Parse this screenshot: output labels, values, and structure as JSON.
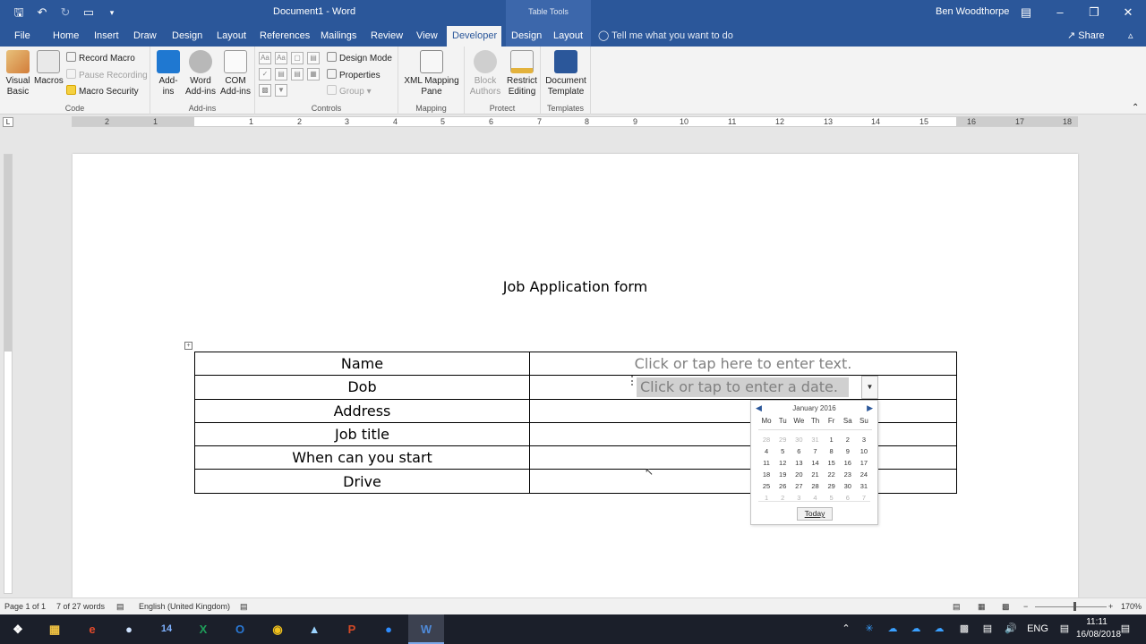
{
  "app": {
    "doc_title": "Document1 - Word",
    "context_tab_label": "Table Tools",
    "user_name": "Ben Woodthorpe",
    "accent": "#2b579a"
  },
  "tabs": [
    "File",
    "Home",
    "Insert",
    "Draw",
    "Design",
    "Layout",
    "References",
    "Mailings",
    "Review",
    "View",
    "Developer",
    "Design",
    "Layout"
  ],
  "active_tab": "Developer",
  "tell_me": "Tell me what you want to do",
  "share_label": "Share",
  "ribbon": {
    "code": {
      "label": "Code",
      "visual_basic": "Visual Basic",
      "macros": "Macros",
      "record_macro": "Record Macro",
      "pause_recording": "Pause Recording",
      "macro_security": "Macro Security"
    },
    "addins": {
      "label": "Add-ins",
      "add_ins": "Add-ins",
      "word_add_ins": "Word Add-ins",
      "com_add_ins": "COM Add-ins"
    },
    "controls": {
      "label": "Controls",
      "design_mode": "Design Mode",
      "properties": "Properties",
      "group": "Group"
    },
    "mapping": {
      "label": "Mapping",
      "xml_mapping_pane": "XML Mapping Pane"
    },
    "protect": {
      "label": "Protect",
      "block_authors": "Block Authors",
      "restrict_editing": "Restrict Editing"
    },
    "templates": {
      "label": "Templates",
      "document_template": "Document Template"
    }
  },
  "ruler": {
    "ticks": [
      "2",
      "1",
      "1",
      "2",
      "3",
      "4",
      "5",
      "6",
      "7",
      "8",
      "9",
      "10",
      "11",
      "12",
      "13",
      "14",
      "15",
      "16",
      "17",
      "18"
    ]
  },
  "document": {
    "heading": "Job Application form",
    "rows": [
      {
        "label": "Name",
        "value": "Click or tap here to enter text."
      },
      {
        "label": "Dob",
        "value": ""
      },
      {
        "label": "Address",
        "value": ""
      },
      {
        "label": "Job title",
        "value": ""
      },
      {
        "label": "When can you start",
        "value": ""
      },
      {
        "label": "Drive",
        "value": ""
      }
    ],
    "date_placeholder": "Click or tap to enter a date."
  },
  "calendar": {
    "month": "January 2016",
    "weekdays": [
      "Mo",
      "Tu",
      "We",
      "Th",
      "Fr",
      "Sa",
      "Su"
    ],
    "days": [
      {
        "d": "28",
        "other": true
      },
      {
        "d": "29",
        "other": true
      },
      {
        "d": "30",
        "other": true
      },
      {
        "d": "31",
        "other": true
      },
      {
        "d": "1"
      },
      {
        "d": "2"
      },
      {
        "d": "3"
      },
      {
        "d": "4"
      },
      {
        "d": "5"
      },
      {
        "d": "6"
      },
      {
        "d": "7"
      },
      {
        "d": "8"
      },
      {
        "d": "9"
      },
      {
        "d": "10"
      },
      {
        "d": "11"
      },
      {
        "d": "12"
      },
      {
        "d": "13"
      },
      {
        "d": "14"
      },
      {
        "d": "15"
      },
      {
        "d": "16"
      },
      {
        "d": "17"
      },
      {
        "d": "18"
      },
      {
        "d": "19"
      },
      {
        "d": "20"
      },
      {
        "d": "21"
      },
      {
        "d": "22"
      },
      {
        "d": "23"
      },
      {
        "d": "24"
      },
      {
        "d": "25"
      },
      {
        "d": "26"
      },
      {
        "d": "27"
      },
      {
        "d": "28"
      },
      {
        "d": "29"
      },
      {
        "d": "30"
      },
      {
        "d": "31"
      },
      {
        "d": "1",
        "other": true
      },
      {
        "d": "2",
        "other": true
      },
      {
        "d": "3",
        "other": true
      },
      {
        "d": "4",
        "other": true
      },
      {
        "d": "5",
        "other": true
      },
      {
        "d": "6",
        "other": true
      },
      {
        "d": "7",
        "other": true
      }
    ],
    "today_label": "Today"
  },
  "status": {
    "page": "Page 1 of 1",
    "words": "7 of 27 words",
    "language": "English (United Kingdom)",
    "zoom": "170%"
  },
  "taskbar": {
    "apps": [
      "start-icon",
      "file-explorer-icon",
      "edge-icon",
      "app-icon",
      "app-14-icon",
      "excel-icon",
      "outlook-icon",
      "chrome-icon",
      "app-icon",
      "powerpoint-icon",
      "zoom-icon",
      "word-icon"
    ],
    "language": "ENG",
    "time": "11:11",
    "date": "16/08/2018"
  }
}
